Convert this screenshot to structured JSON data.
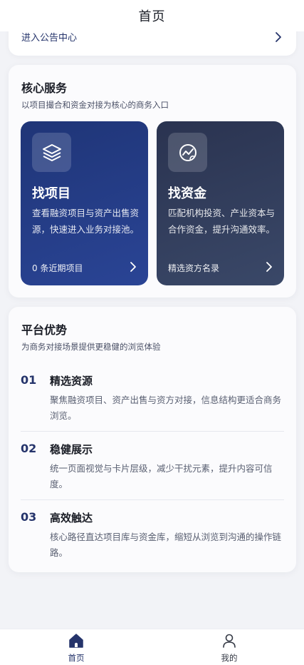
{
  "header": {
    "title": "首页"
  },
  "notice": {
    "link_label": "进入公告中心"
  },
  "services": {
    "title": "核心服务",
    "subtitle": "以项目撮合和资金对接为核心的商务入口",
    "cards": [
      {
        "icon": "layers-icon",
        "title": "找项目",
        "desc": "查看融资项目与资产出售资源，快速进入业务对接池。",
        "footer": "0 条近期项目"
      },
      {
        "icon": "globe-chart-icon",
        "title": "找资金",
        "desc": "匹配机构投资、产业资本与合作资金，提升沟通效率。",
        "footer": "精选资方名录"
      }
    ]
  },
  "advantages": {
    "title": "平台优势",
    "subtitle": "为商务对接场景提供更稳健的浏览体验",
    "items": [
      {
        "num": "01",
        "title": "精选资源",
        "desc": "聚焦融资项目、资产出售与资方对接，信息结构更适合商务浏览。"
      },
      {
        "num": "02",
        "title": "稳健展示",
        "desc": "统一页面视觉与卡片层级，减少干扰元素，提升内容可信度。"
      },
      {
        "num": "03",
        "title": "高效触达",
        "desc": "核心路径直达项目库与资金库，缩短从浏览到沟通的操作链路。"
      }
    ]
  },
  "tabbar": {
    "items": [
      {
        "label": "首页",
        "icon": "home-icon",
        "active": true
      },
      {
        "label": "我的",
        "icon": "user-icon",
        "active": false
      }
    ]
  },
  "colors": {
    "accent": "#25346b",
    "card_project": "#22397f",
    "card_fund": "#2f3a58",
    "background": "#f2f3f7"
  }
}
